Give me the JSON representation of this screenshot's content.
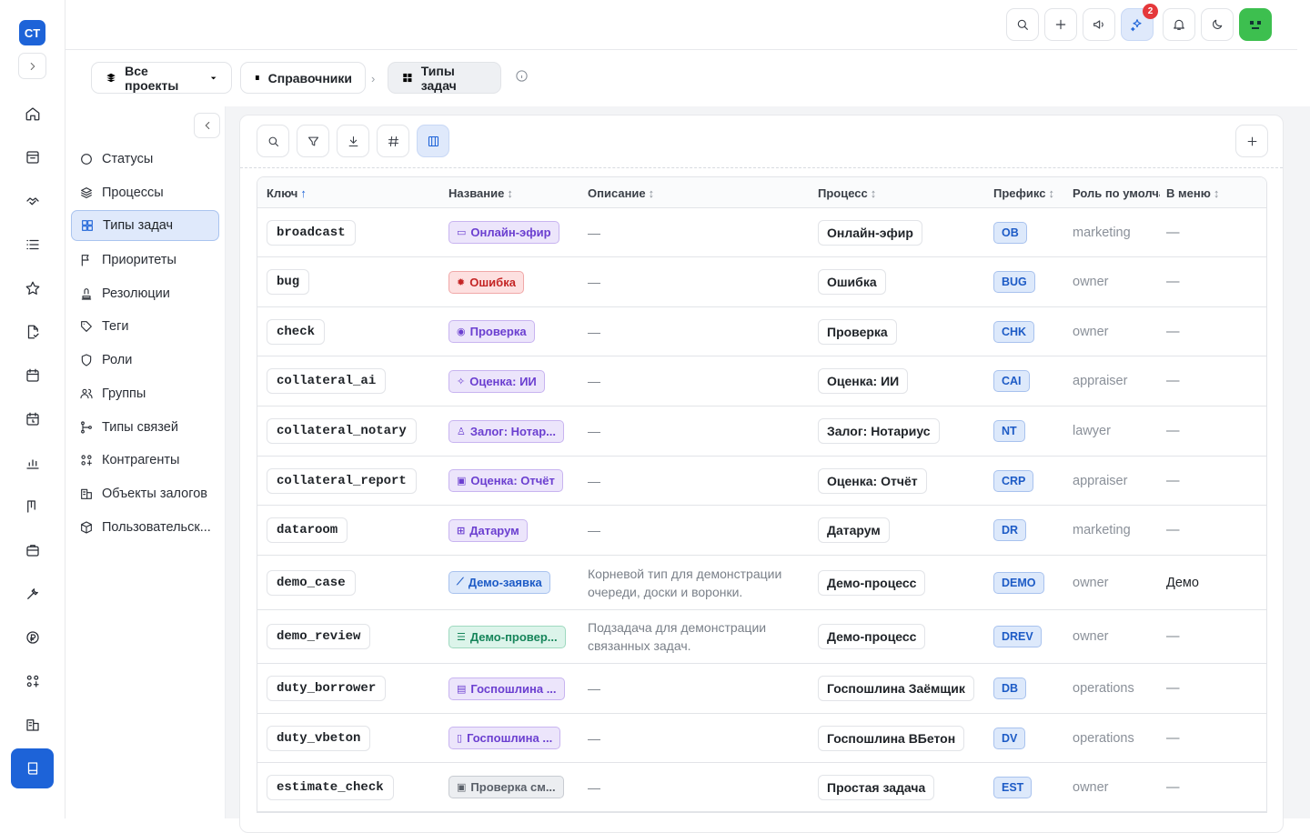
{
  "app": {
    "logo_text": "CT"
  },
  "topbar": {
    "notifications_badge": "2"
  },
  "breadcrumbs": [
    {
      "label": "Все проекты"
    },
    {
      "label": "Справочники"
    },
    {
      "label": "Типы задач"
    }
  ],
  "sidebar": {
    "items": [
      {
        "label": "Статусы",
        "icon": "circle-icon"
      },
      {
        "label": "Процессы",
        "icon": "layers-icon"
      },
      {
        "label": "Типы задач",
        "icon": "grid-icon",
        "active": true
      },
      {
        "label": "Приоритеты",
        "icon": "flag-icon"
      },
      {
        "label": "Резолюции",
        "icon": "stamp-icon"
      },
      {
        "label": "Теги",
        "icon": "tag-icon"
      },
      {
        "label": "Роли",
        "icon": "shield-icon"
      },
      {
        "label": "Группы",
        "icon": "users-icon"
      },
      {
        "label": "Типы связей",
        "icon": "branch-icon"
      },
      {
        "label": "Контрагенты",
        "icon": "counterparty-icon"
      },
      {
        "label": "Объекты залогов",
        "icon": "building-icon"
      },
      {
        "label": "Пользовательск...",
        "icon": "box-icon"
      }
    ]
  },
  "table": {
    "headers": {
      "key": "Ключ",
      "name": "Название",
      "description": "Описание",
      "process": "Процесс",
      "prefix": "Префикс",
      "role": "Роль по умолча",
      "menu": "В меню"
    },
    "rows": [
      {
        "key": "broadcast",
        "name": "Онлайн-эфир",
        "color": "purple",
        "icon": "video-icon",
        "description": "—",
        "process": "Онлайн-эфир",
        "prefix": "OB",
        "role": "marketing",
        "menu": "—"
      },
      {
        "key": "bug",
        "name": "Ошибка",
        "color": "red",
        "icon": "bug-icon",
        "description": "—",
        "process": "Ошибка",
        "prefix": "BUG",
        "role": "owner",
        "menu": "—"
      },
      {
        "key": "check",
        "name": "Проверка",
        "color": "purple",
        "icon": "eye-icon",
        "description": "—",
        "process": "Проверка",
        "prefix": "CHK",
        "role": "owner",
        "menu": "—"
      },
      {
        "key": "collateral_ai",
        "name": "Оценка: ИИ",
        "color": "purple",
        "icon": "sparkle-icon",
        "description": "—",
        "process": "Оценка: ИИ",
        "prefix": "CAI",
        "role": "appraiser",
        "menu": "—"
      },
      {
        "key": "collateral_notary",
        "name": "Залог: Нотар...",
        "color": "purple",
        "icon": "stamp-icon",
        "description": "—",
        "process": "Залог: Нотариус",
        "prefix": "NT",
        "role": "lawyer",
        "menu": "—"
      },
      {
        "key": "collateral_report",
        "name": "Оценка: Отчёт",
        "color": "purple",
        "icon": "clipboard-icon",
        "description": "—",
        "process": "Оценка: Отчёт",
        "prefix": "CRP",
        "role": "appraiser",
        "menu": "—"
      },
      {
        "key": "dataroom",
        "name": "Датарум",
        "color": "purple",
        "icon": "archive-icon",
        "description": "—",
        "process": "Датарум",
        "prefix": "DR",
        "role": "marketing",
        "menu": "—"
      },
      {
        "key": "demo_case",
        "name": "Демо-заявка",
        "color": "blue",
        "icon": "wand-icon",
        "description": "Корневой тип для демонстрации очереди, доски и воронки.",
        "process": "Демо-процесс",
        "prefix": "DEMO",
        "role": "owner",
        "menu": "Демо"
      },
      {
        "key": "demo_review",
        "name": "Демо-провер...",
        "color": "green",
        "icon": "list-icon",
        "description": "Подзадача для демонстрации связанных задач.",
        "process": "Демо-процесс",
        "prefix": "DREV",
        "role": "owner",
        "menu": "—"
      },
      {
        "key": "duty_borrower",
        "name": "Госпошлина ...",
        "color": "purple",
        "icon": "receipt-icon",
        "description": "—",
        "process": "Госпошлина Заёмщик",
        "prefix": "DB",
        "role": "operations",
        "menu": "—"
      },
      {
        "key": "duty_vbeton",
        "name": "Госпошлина ...",
        "color": "purple",
        "icon": "book-icon",
        "description": "—",
        "process": "Госпошлина ВБетон",
        "prefix": "DV",
        "role": "operations",
        "menu": "—"
      },
      {
        "key": "estimate_check",
        "name": "Проверка см...",
        "color": "gray",
        "icon": "clipboard-check-icon",
        "description": "—",
        "process": "Простая задача",
        "prefix": "EST",
        "role": "owner",
        "menu": "—"
      }
    ]
  }
}
